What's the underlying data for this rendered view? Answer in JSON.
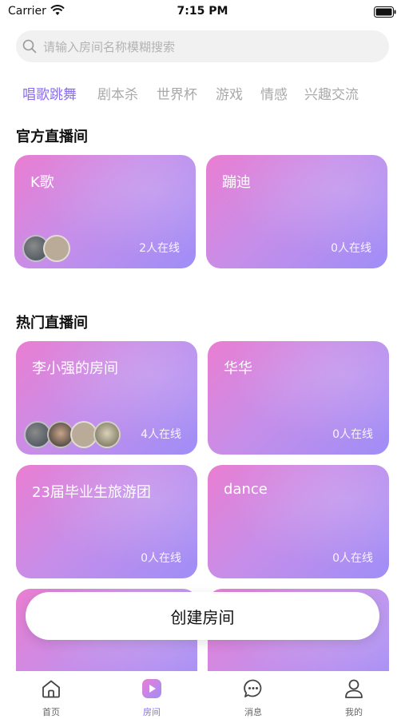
{
  "status_bar": {
    "carrier": "Carrier",
    "time": "7:15 PM"
  },
  "search": {
    "placeholder": "请输入房间名称模糊搜索"
  },
  "categories": [
    "唱歌跳舞",
    "剧本杀",
    "世界杯",
    "游戏",
    "情感",
    "兴趣交流"
  ],
  "official": {
    "title": "官方直播间",
    "rooms": [
      {
        "name": "K歌",
        "online": "2人在线"
      },
      {
        "name": "蹦迪",
        "online": "0人在线"
      }
    ]
  },
  "hot": {
    "title": "热门直播间",
    "rooms": [
      {
        "name": "李小强的房间",
        "online": "4人在线"
      },
      {
        "name": "华华",
        "online": "0人在线"
      },
      {
        "name": "23届毕业生旅游团",
        "online": "0人在线"
      },
      {
        "name": "dance",
        "online": "0人在线"
      }
    ]
  },
  "create_button": "创建房间",
  "tabbar": [
    {
      "label": "首页",
      "icon": "home-icon"
    },
    {
      "label": "房间",
      "icon": "play-icon"
    },
    {
      "label": "消息",
      "icon": "chat-icon"
    },
    {
      "label": "我的",
      "icon": "user-icon"
    }
  ],
  "colors": {
    "accent": "#8b6cf0",
    "card_start": "#ea7ed2",
    "card_end": "#9f8ef7"
  }
}
